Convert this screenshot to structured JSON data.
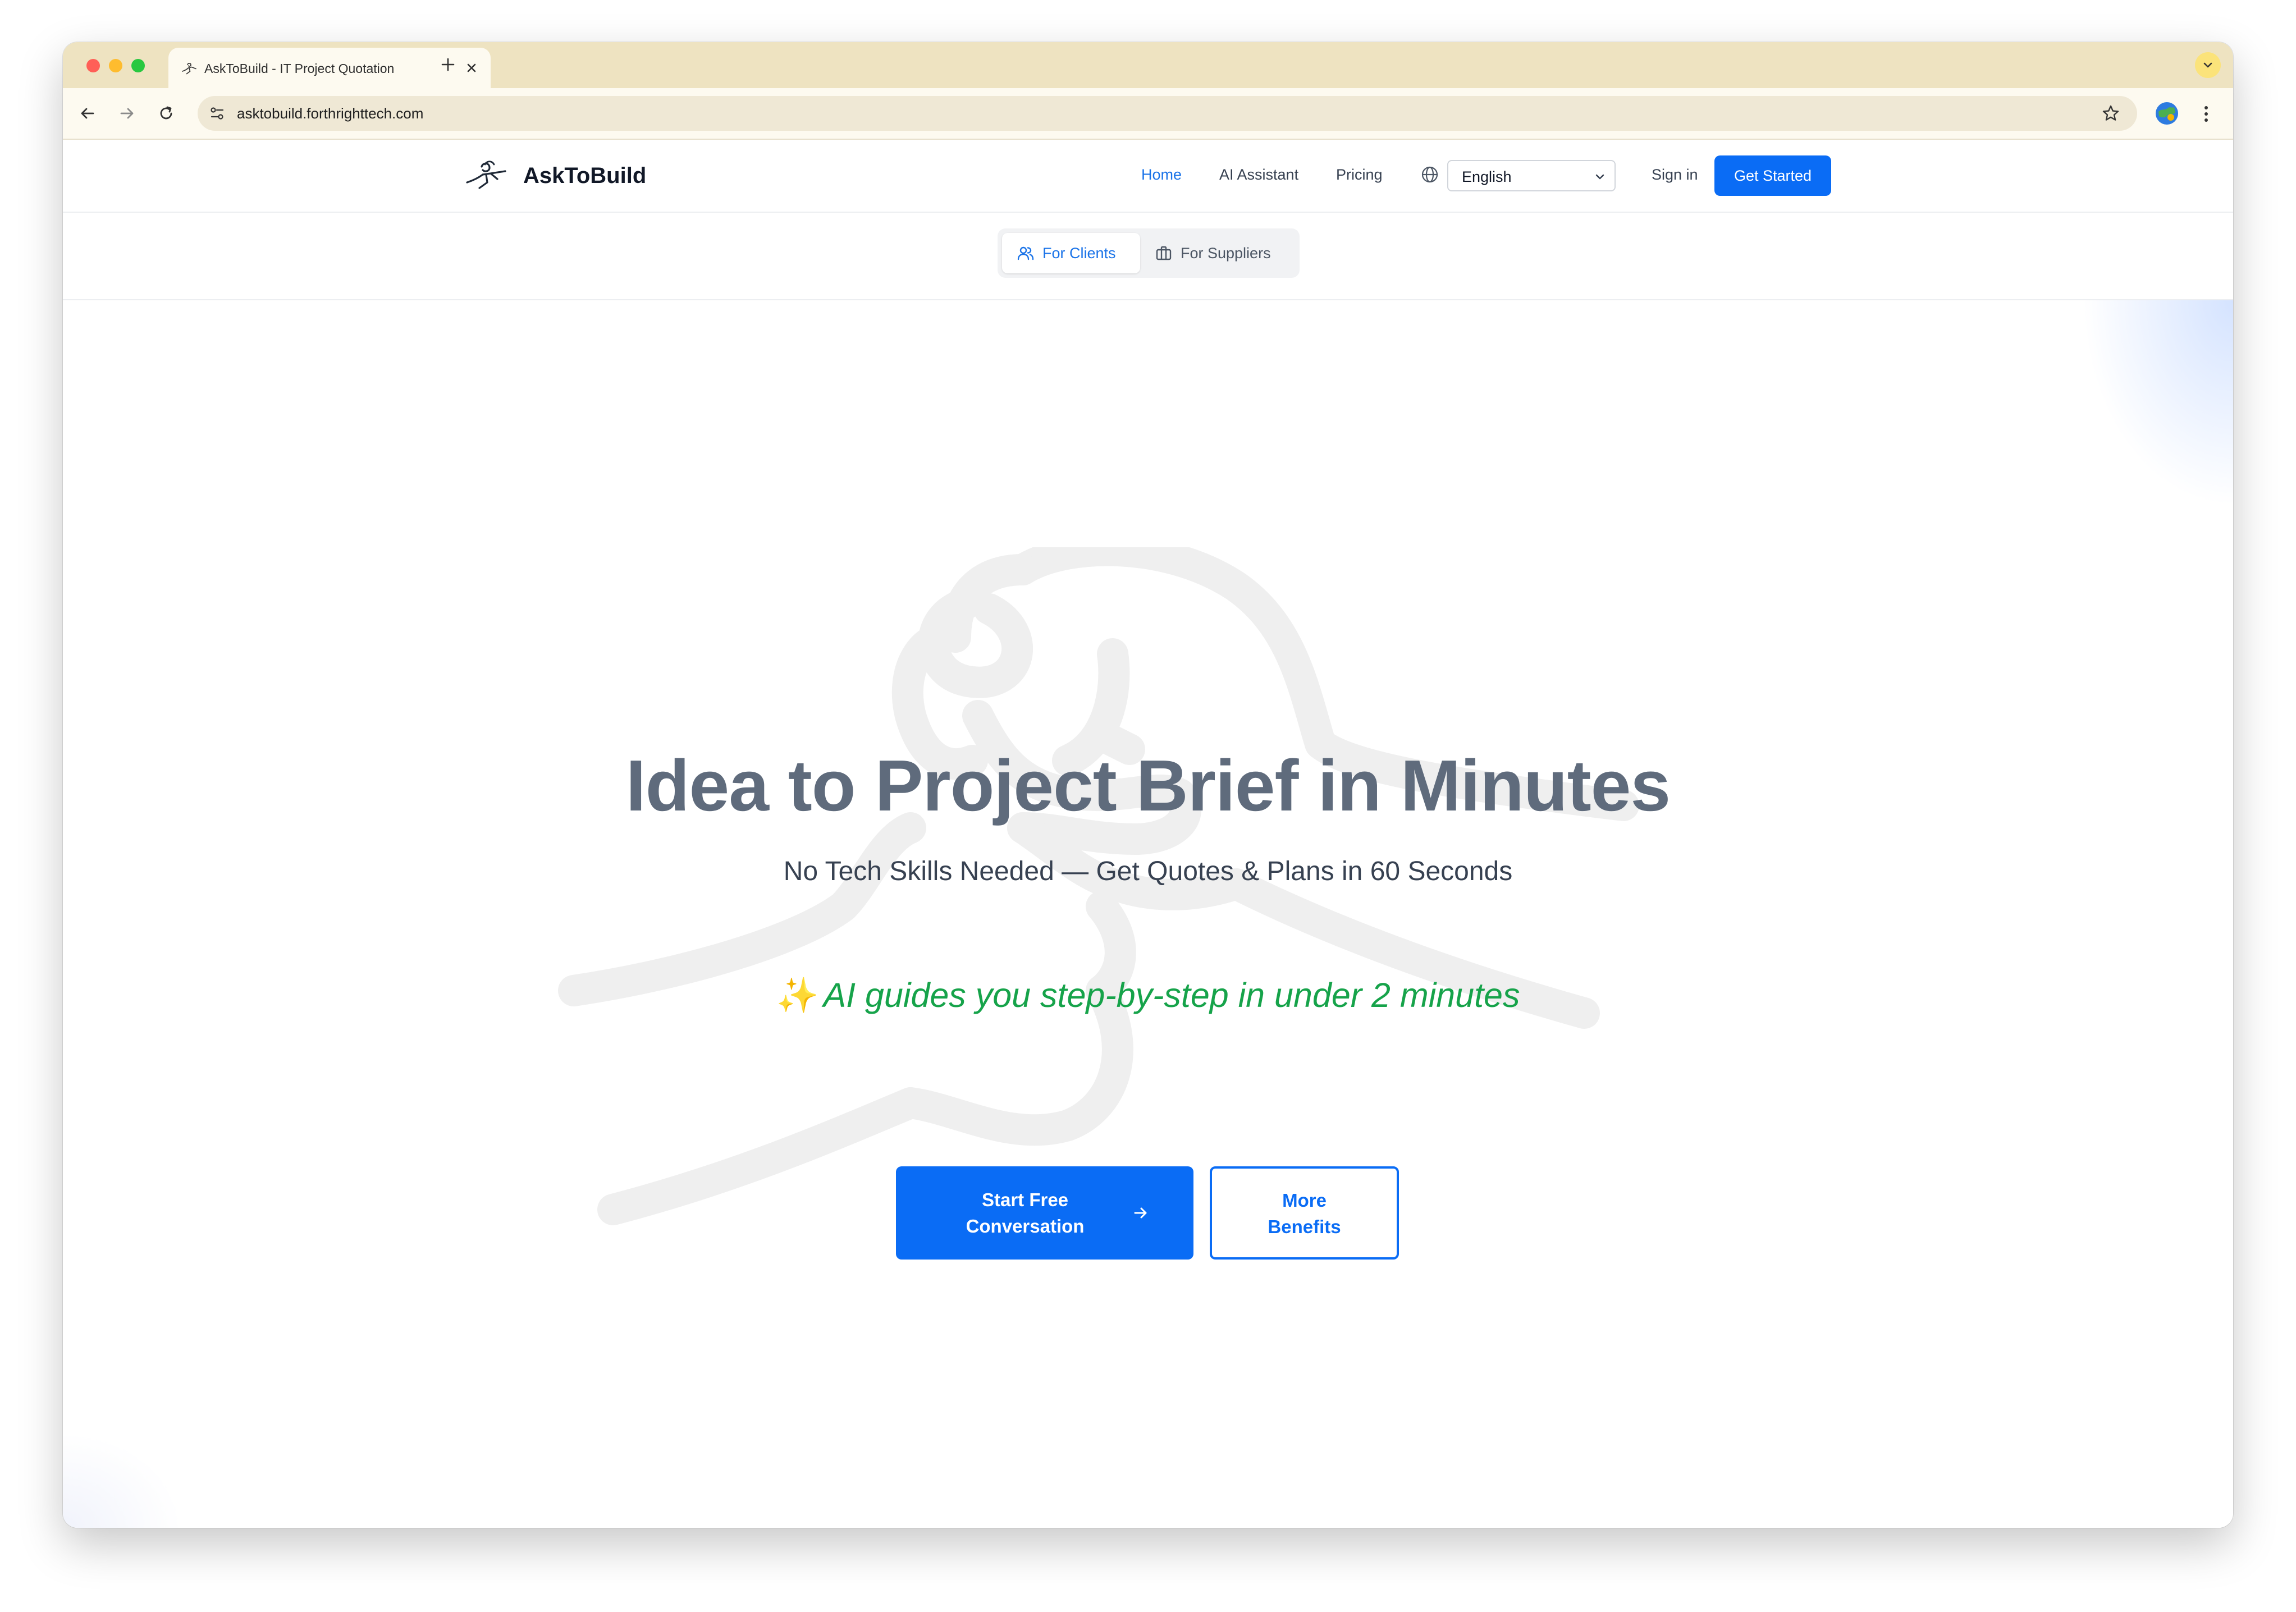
{
  "browser": {
    "tab_title": "AskToBuild - IT Project Quotation",
    "url": "asktobuild.forthrighttech.com"
  },
  "header": {
    "brand": "AskToBuild",
    "nav": {
      "home": "Home",
      "ai_assistant": "AI Assistant",
      "pricing": "Pricing"
    },
    "language": "English",
    "sign_in": "Sign in",
    "get_started": "Get Started"
  },
  "audience_switch": {
    "clients": "For Clients",
    "suppliers": "For Suppliers",
    "selected": "For Clients"
  },
  "hero": {
    "title": "Idea to Project Brief in Minutes",
    "subtitle": "No Tech Skills Needed — Get Quotes & Plans in 60 Seconds",
    "tagline_icon": "✨",
    "tagline": "AI guides you step-by-step in under 2 minutes",
    "cta_primary_line1": "Start Free",
    "cta_primary_line2": "Conversation",
    "cta_secondary_line1": "More",
    "cta_secondary_line2": "Benefits"
  },
  "colors": {
    "accent": "#0a6cf5",
    "tagline_green": "#16a34a",
    "title_gray": "#5f6b7c",
    "browser_chrome": "#eee3c1"
  }
}
